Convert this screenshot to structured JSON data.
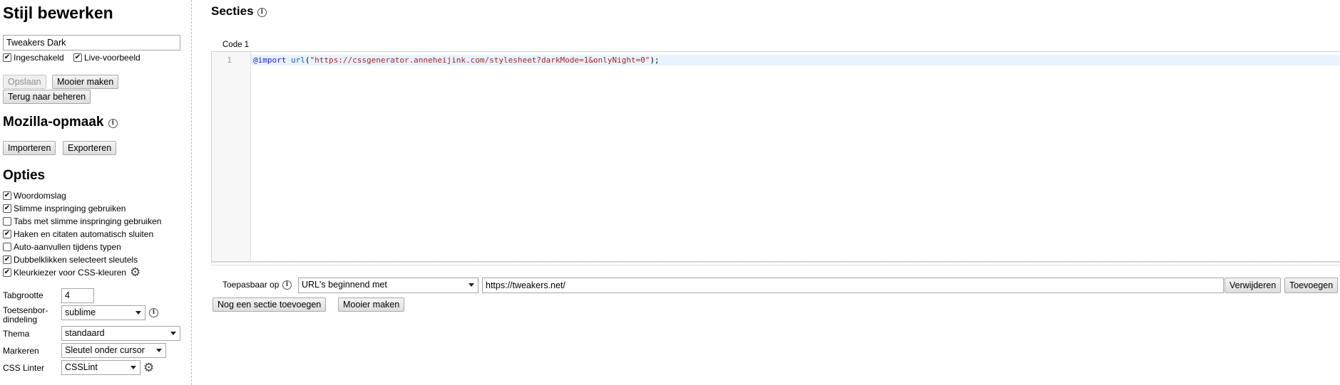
{
  "sidebar": {
    "title": "Stijl bewerken",
    "style_name": "Tweakers Dark",
    "enabled_label": "Ingeschakeld",
    "enabled_checked": true,
    "live_preview_label": "Live-voorbeeld",
    "live_preview_checked": true,
    "save_label": "Opslaan",
    "beautify_label": "Mooier maken",
    "back_label": "Terug naar beheren",
    "mozilla_title": "Mozilla-opmaak",
    "import_label": "Importeren",
    "export_label": "Exporteren",
    "options_title": "Opties",
    "options": [
      {
        "label": "Woordomslag",
        "checked": true
      },
      {
        "label": "Slimme inspringing gebruiken",
        "checked": true
      },
      {
        "label": "Tabs met slimme inspringing gebruiken",
        "checked": false
      },
      {
        "label": "Haken en citaten automatisch sluiten",
        "checked": true
      },
      {
        "label": "Auto-aanvullen tijdens typen",
        "checked": false
      },
      {
        "label": "Dubbelklikken selecteert sleutels",
        "checked": true
      },
      {
        "label": "Kleurkiezer voor CSS-kleuren",
        "checked": true
      }
    ],
    "tab_size_label": "Tabgrootte",
    "tab_size_value": "4",
    "keymap_label_1": "Toetsenbor-",
    "keymap_label_2": "dindeling",
    "keymap_value": "sublime",
    "theme_label": "Thema",
    "theme_value": "standaard",
    "highlight_label": "Markeren",
    "highlight_value": "Sleutel onder cursor",
    "linter_label": "CSS Linter",
    "linter_value": "CSSLint"
  },
  "main": {
    "sections_title": "Secties",
    "code_label": "Code 1",
    "line_number": "1",
    "code_keyword": "@import",
    "code_fn": "url",
    "code_open": "(",
    "code_string": "\"https://cssgenerator.anneheijink.com/stylesheet?darkMode=1&onlyNight=0\"",
    "code_close": ");",
    "applies_to_label": "Toepasbaar op",
    "applies_type_value": "URL's beginnend met",
    "applies_url_value": "https://tweakers.net/",
    "remove_label": "Verwijderen",
    "add_label": "Toevoegen",
    "add_section_label": "Nog een sectie toevoegen",
    "beautify_label": "Mooier maken"
  }
}
